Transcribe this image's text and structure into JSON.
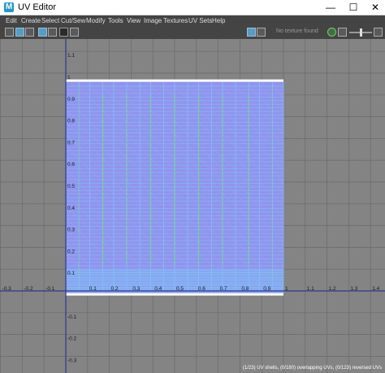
{
  "window": {
    "title": "UV Editor",
    "minimize": "—",
    "maximize": "☐",
    "close": "✕"
  },
  "menu": [
    "Edit",
    "Create",
    "Select",
    "Cut/Sew",
    "Modify",
    "Tools",
    "View",
    "Image",
    "Textures",
    "UV Sets",
    "Help"
  ],
  "toolbar": {
    "texture_status": "No texture found",
    "texture_brightness": 0.5,
    "left_tools": [
      "uv-select-icon",
      "uv-shell-icon",
      "uv-texture-icon",
      "frame-icon",
      "grid-display-icon",
      "isolate-icon",
      "screenshot-icon"
    ],
    "right_tools": [
      "texture-display-icon",
      "checker-icon",
      "refresh-icon",
      "layout-icon",
      "image-range-icon"
    ]
  },
  "viewport": {
    "axis_u_labels": [
      "-0.3",
      "-0.2",
      "-0.1",
      "0.1",
      "0.2",
      "0.3",
      "0.4",
      "0.5",
      "0.6",
      "0.7",
      "0.8",
      "0.9",
      "1",
      "1.1",
      "1.2",
      "1.3",
      "1.4"
    ],
    "axis_v_labels": [
      "1.1",
      "1",
      "0.9",
      "0.8",
      "0.7",
      "0.6",
      "0.5",
      "0.4",
      "0.3",
      "0.2",
      "0.1",
      "-0.1",
      "-0.2",
      "-0.3"
    ],
    "colors": {
      "background": "#848484",
      "grid": "#6a6a6a",
      "uv_fill": "#8f94ef",
      "wire": "#7fc6f5",
      "seam": "#6de46d",
      "diag": "#d38fe6",
      "axis": "#2b3a8c"
    }
  },
  "status_text": "(1/23) UV shells, (0/180) overlapping UVs, (0/123) reversed UVs"
}
